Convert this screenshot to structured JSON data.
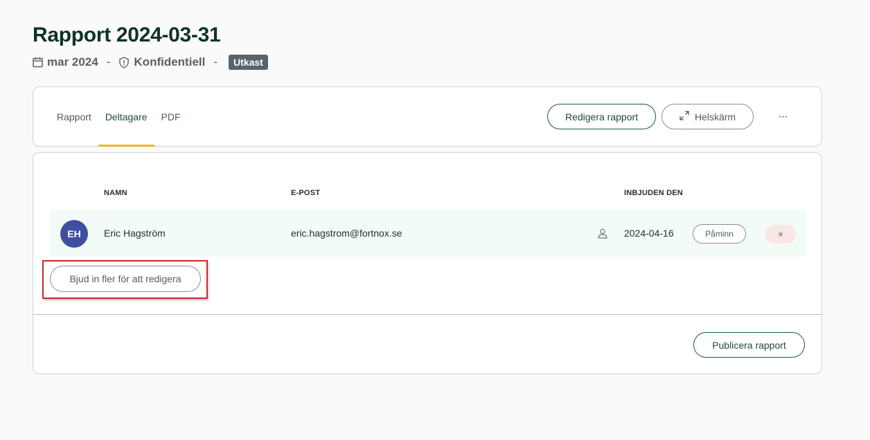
{
  "header": {
    "title": "Rapport 2024-03-31",
    "date": "mar 2024",
    "separator": "-",
    "confidentiality": "Konfidentiell",
    "status_badge": "Utkast"
  },
  "tabs": [
    {
      "label": "Rapport",
      "active": false
    },
    {
      "label": "Deltagare",
      "active": true
    },
    {
      "label": "PDF",
      "active": false
    }
  ],
  "toolbar": {
    "edit_label": "Redigera rapport",
    "fullscreen_label": "Helskärm",
    "more_label": "···"
  },
  "table": {
    "headers": {
      "name": "NAMN",
      "email": "E-POST",
      "invited": "INBJUDEN DEN"
    },
    "rows": [
      {
        "initials": "EH",
        "name": "Eric Hagström",
        "email": "eric.hagstrom@fortnox.se",
        "invited": "2024-04-16",
        "remind_label": "Påminn",
        "remove_label": "×"
      }
    ]
  },
  "actions": {
    "invite_label": "Bjud in fler för att redigera",
    "publish_label": "Publicera rapport"
  },
  "colors": {
    "accent_tab": "#f2b625",
    "avatar": "#3f4f9e",
    "highlight": "#d0262c",
    "badge": "#58646d"
  }
}
